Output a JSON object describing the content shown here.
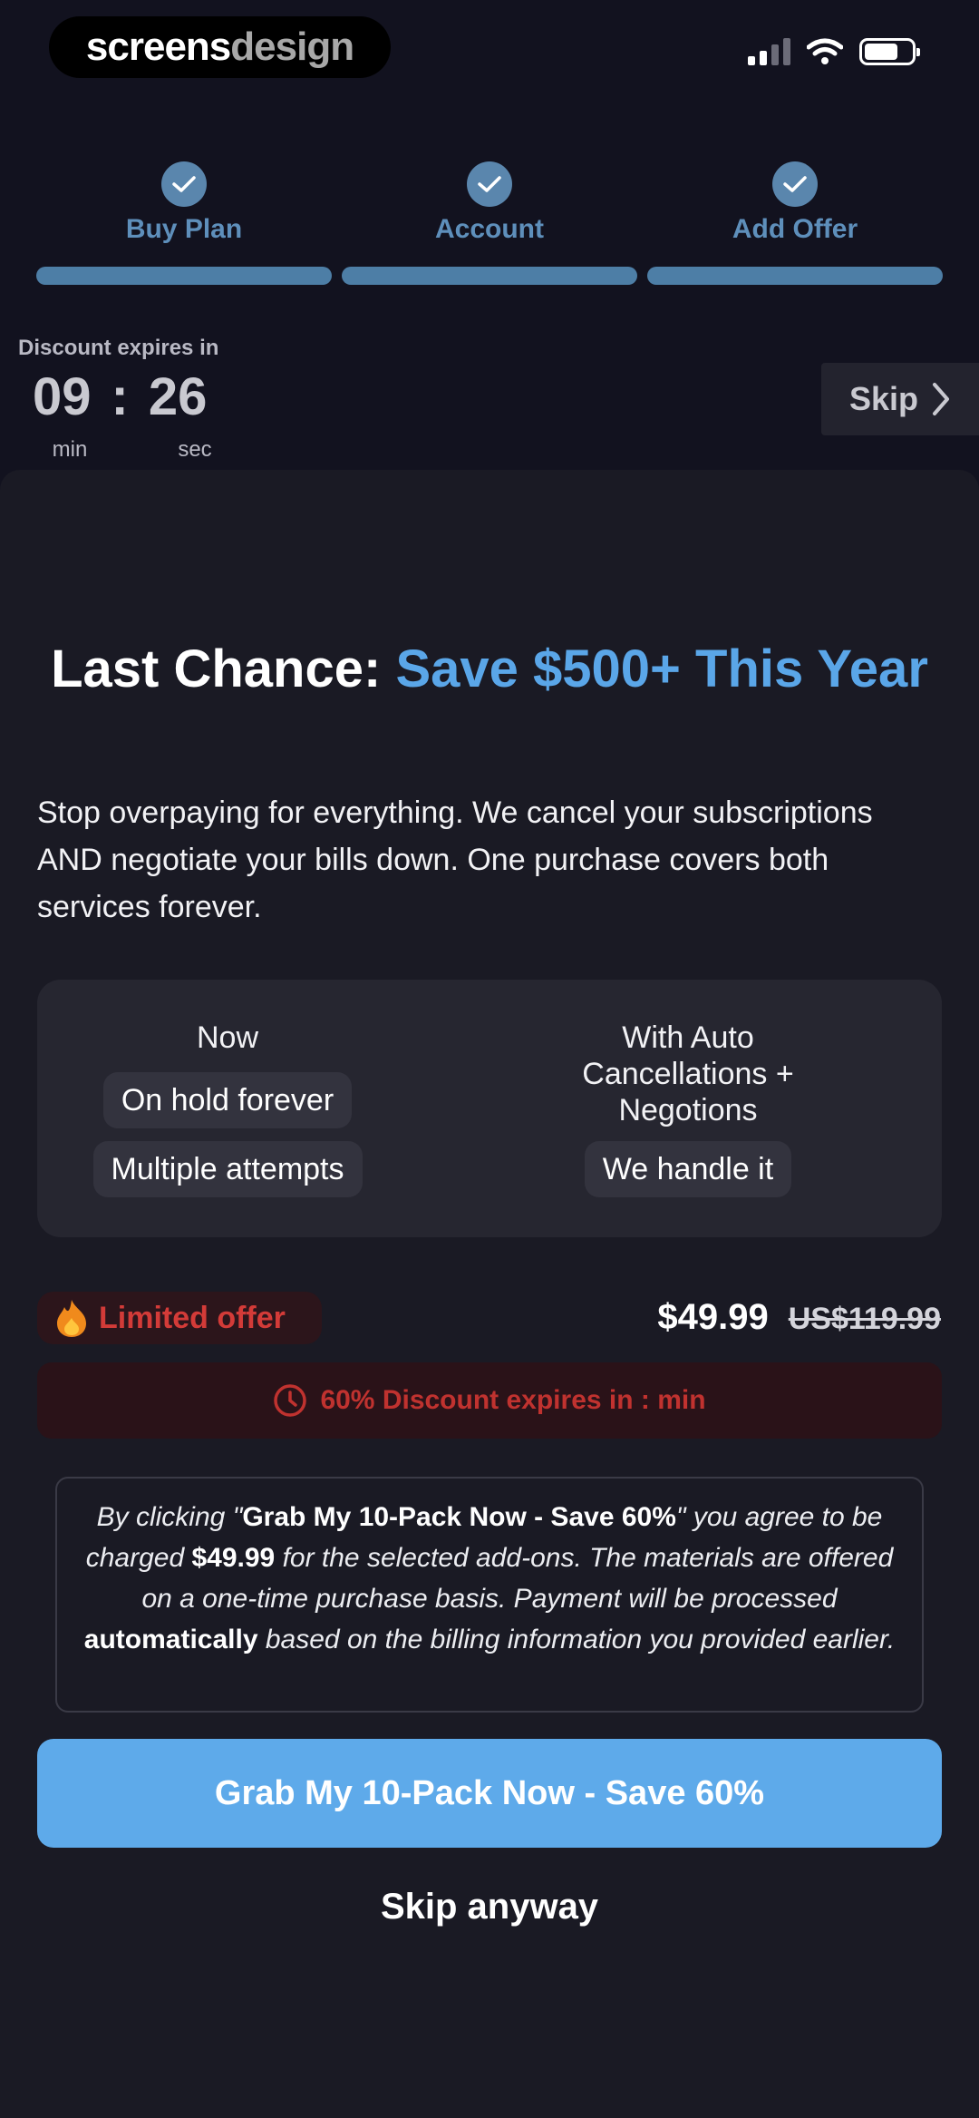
{
  "status_bar": {
    "brand_part1": "screens",
    "brand_part2": "design",
    "icons": [
      "signal-icon",
      "wifi-icon",
      "battery-icon"
    ]
  },
  "steps": [
    {
      "label": "Buy Plan",
      "icon": "check-icon"
    },
    {
      "label": "Account",
      "icon": "check-icon"
    },
    {
      "label": "Add Offer",
      "icon": "check-icon"
    }
  ],
  "timer": {
    "title": "Discount expires in",
    "minutes": "09",
    "separator": ":",
    "seconds": "26",
    "min_label": "min",
    "sec_label": "sec"
  },
  "skip": {
    "label": "Skip",
    "icon": "chevron-right-icon"
  },
  "headline": {
    "part1": "Last Chance: ",
    "accent": "Save $500+ This Year"
  },
  "subtext": "Stop overpaying for everything. We cancel your subscriptions AND negotiate your bills down. One purchase covers both services forever.",
  "compare": {
    "now": {
      "title": "Now",
      "items": [
        "On hold forever",
        "Multiple attempts"
      ]
    },
    "auto": {
      "title": "With Auto Cancellations + Negotions",
      "items": [
        "We handle it"
      ]
    }
  },
  "offer": {
    "badge": "Limited offer",
    "badge_icon": "fire-icon",
    "price": "$49.99",
    "old_price": "US$119.99",
    "discount_text": "60% Discount expires in : min",
    "discount_icon": "clock-icon"
  },
  "terms": {
    "t1": "By clicking \"",
    "b1": "Grab My 10-Pack Now - Save 60%",
    "t2": "\" you agree to be charged ",
    "b2": "$49.99",
    "t3": " for the selected add-ons. The materials are offered on a one-time purchase basis. Payment will be processed ",
    "b3": "automatically",
    "t4": " based on the billing information you provided earlier."
  },
  "cta_label": "Grab My 10-Pack Now - Save 60%",
  "skip_anyway": "Skip anyway",
  "colors": {
    "background": "#12121f",
    "accent": "#5eaaea",
    "step": "#5a86ad",
    "danger": "#d33b38"
  }
}
